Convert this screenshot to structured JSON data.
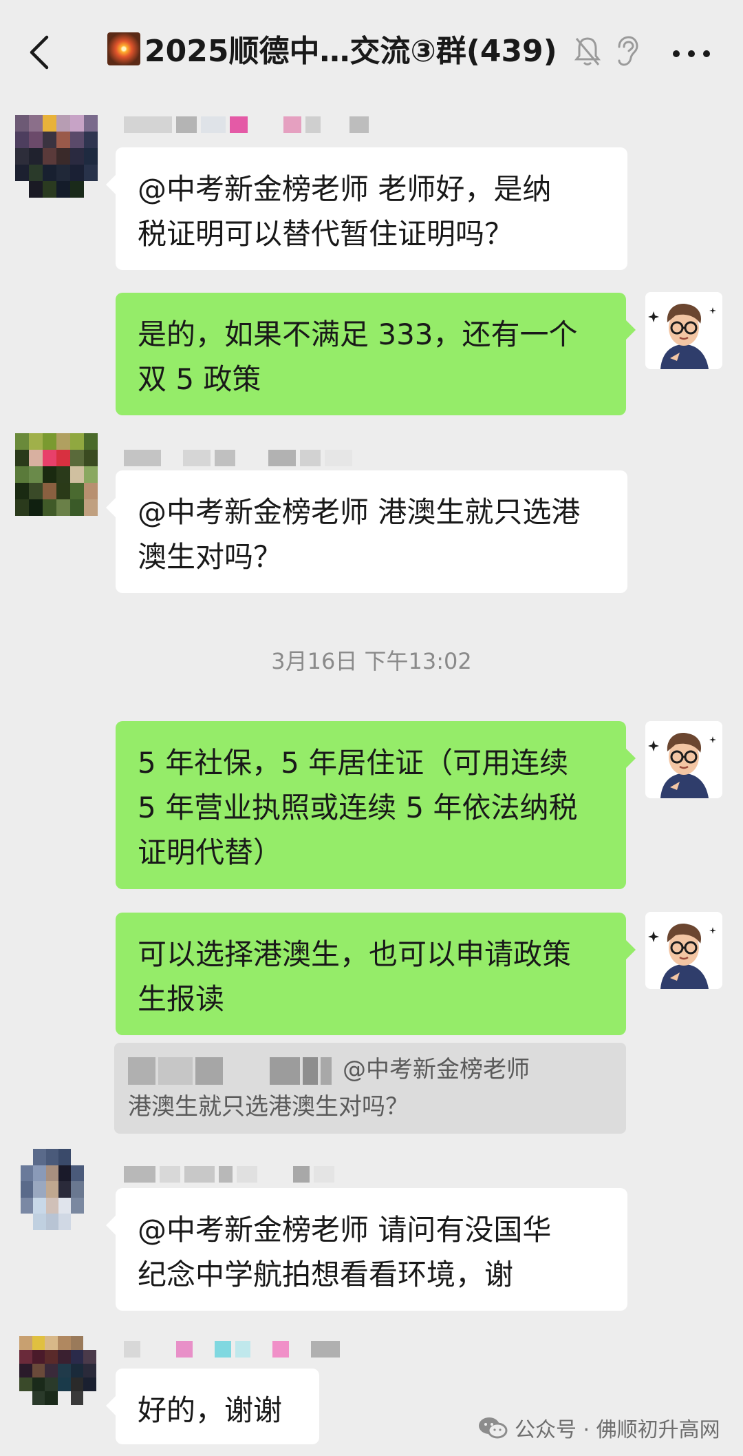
{
  "header": {
    "title": "2025顺德中…交流③群(439)",
    "title_emoji": "fireworks-emoji",
    "icons": [
      "back-arrow-icon",
      "bell-muted-icon",
      "ear-icon",
      "more-icon"
    ]
  },
  "messages": [
    {
      "side": "left",
      "text_lines": [
        "@中考新金榜老师  老师好，是纳",
        "税证明可以替代暂住证明吗？"
      ]
    },
    {
      "side": "right",
      "text_lines": [
        "是的，如果不满足 333，还有一个",
        "双 5 政策"
      ]
    },
    {
      "side": "left",
      "text_lines": [
        "@中考新金榜老师 港澳生就只选港",
        "澳生对吗？"
      ]
    },
    {
      "side": "right",
      "text_lines": [
        "5 年社保，5 年居住证（可用连续",
        "5 年营业执照或连续 5 年依法纳税",
        "证明代替）"
      ]
    },
    {
      "side": "right",
      "text_lines": [
        "可以选择港澳生，也可以申请政策",
        "生报读"
      ]
    },
    {
      "side": "left",
      "text_lines": [
        "@中考新金榜老师  请问有没国华",
        "纪念中学航拍想看看环境，谢"
      ]
    },
    {
      "side": "left",
      "text_lines": [
        "好的，谢谢"
      ]
    }
  ],
  "timestamp": "3月16日 下午13:02",
  "quote": {
    "line1": "@中考新金榜老师",
    "line2": "港澳生就只选港澳生对吗？"
  },
  "watermark": {
    "text": "公众号 · 佛顺初升高网",
    "icon": "wechat-icon"
  },
  "colors": {
    "background": "#ededed",
    "self_bubble": "#95ec69",
    "other_bubble": "#ffffff",
    "timestamp_text": "#8a8a8a"
  }
}
